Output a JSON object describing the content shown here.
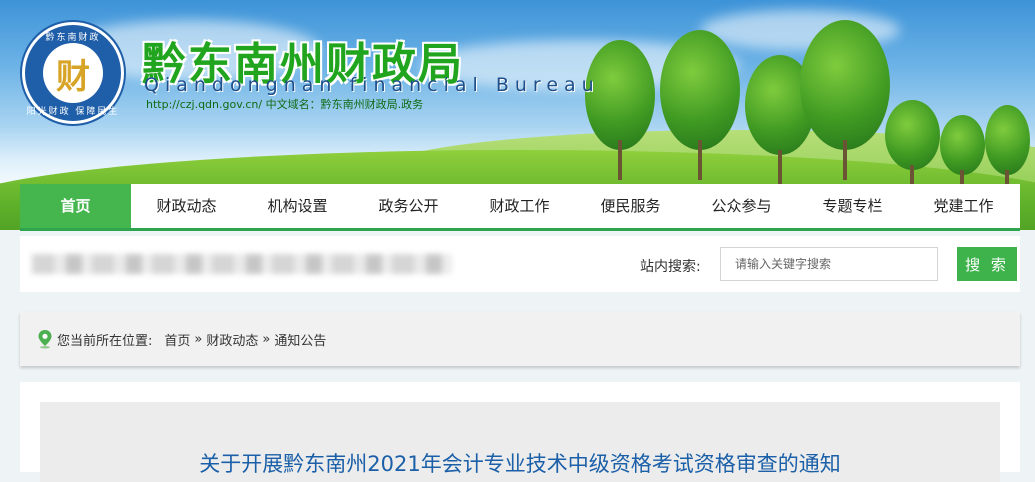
{
  "header": {
    "site_title": "黔东南州财政局",
    "site_subtitle": "Qiandongnan financial Bureau",
    "url_text": "http://czj.qdn.gov.cn/ 中文域名：黔东南州财政局.政务",
    "logo": {
      "center_glyph": "财",
      "ring_top": "黔东南财政",
      "ring_bottom": "阳光财政 保障民生",
      "colors": {
        "ring": "#1f5ea8",
        "glyph": "#d7a428"
      }
    }
  },
  "nav": {
    "items": [
      {
        "label": "首页",
        "active": true
      },
      {
        "label": "财政动态"
      },
      {
        "label": "机构设置"
      },
      {
        "label": "政务公开"
      },
      {
        "label": "财政工作"
      },
      {
        "label": "便民服务"
      },
      {
        "label": "公众参与"
      },
      {
        "label": "专题专栏"
      },
      {
        "label": "党建工作"
      }
    ],
    "accent_color": "#45b64e"
  },
  "search": {
    "label": "站内搜索:",
    "placeholder": "请输入关键字搜索",
    "button_label": "搜 索"
  },
  "breadcrumb": {
    "prefix": "您当前所在位置:",
    "items": [
      "首页",
      "财政动态",
      "通知公告"
    ],
    "separator": "»"
  },
  "article": {
    "title": "关于开展黔东南州2021年会计专业技术中级资格考试资格审查的通知"
  },
  "icons": {
    "location": "map-pin-icon"
  }
}
